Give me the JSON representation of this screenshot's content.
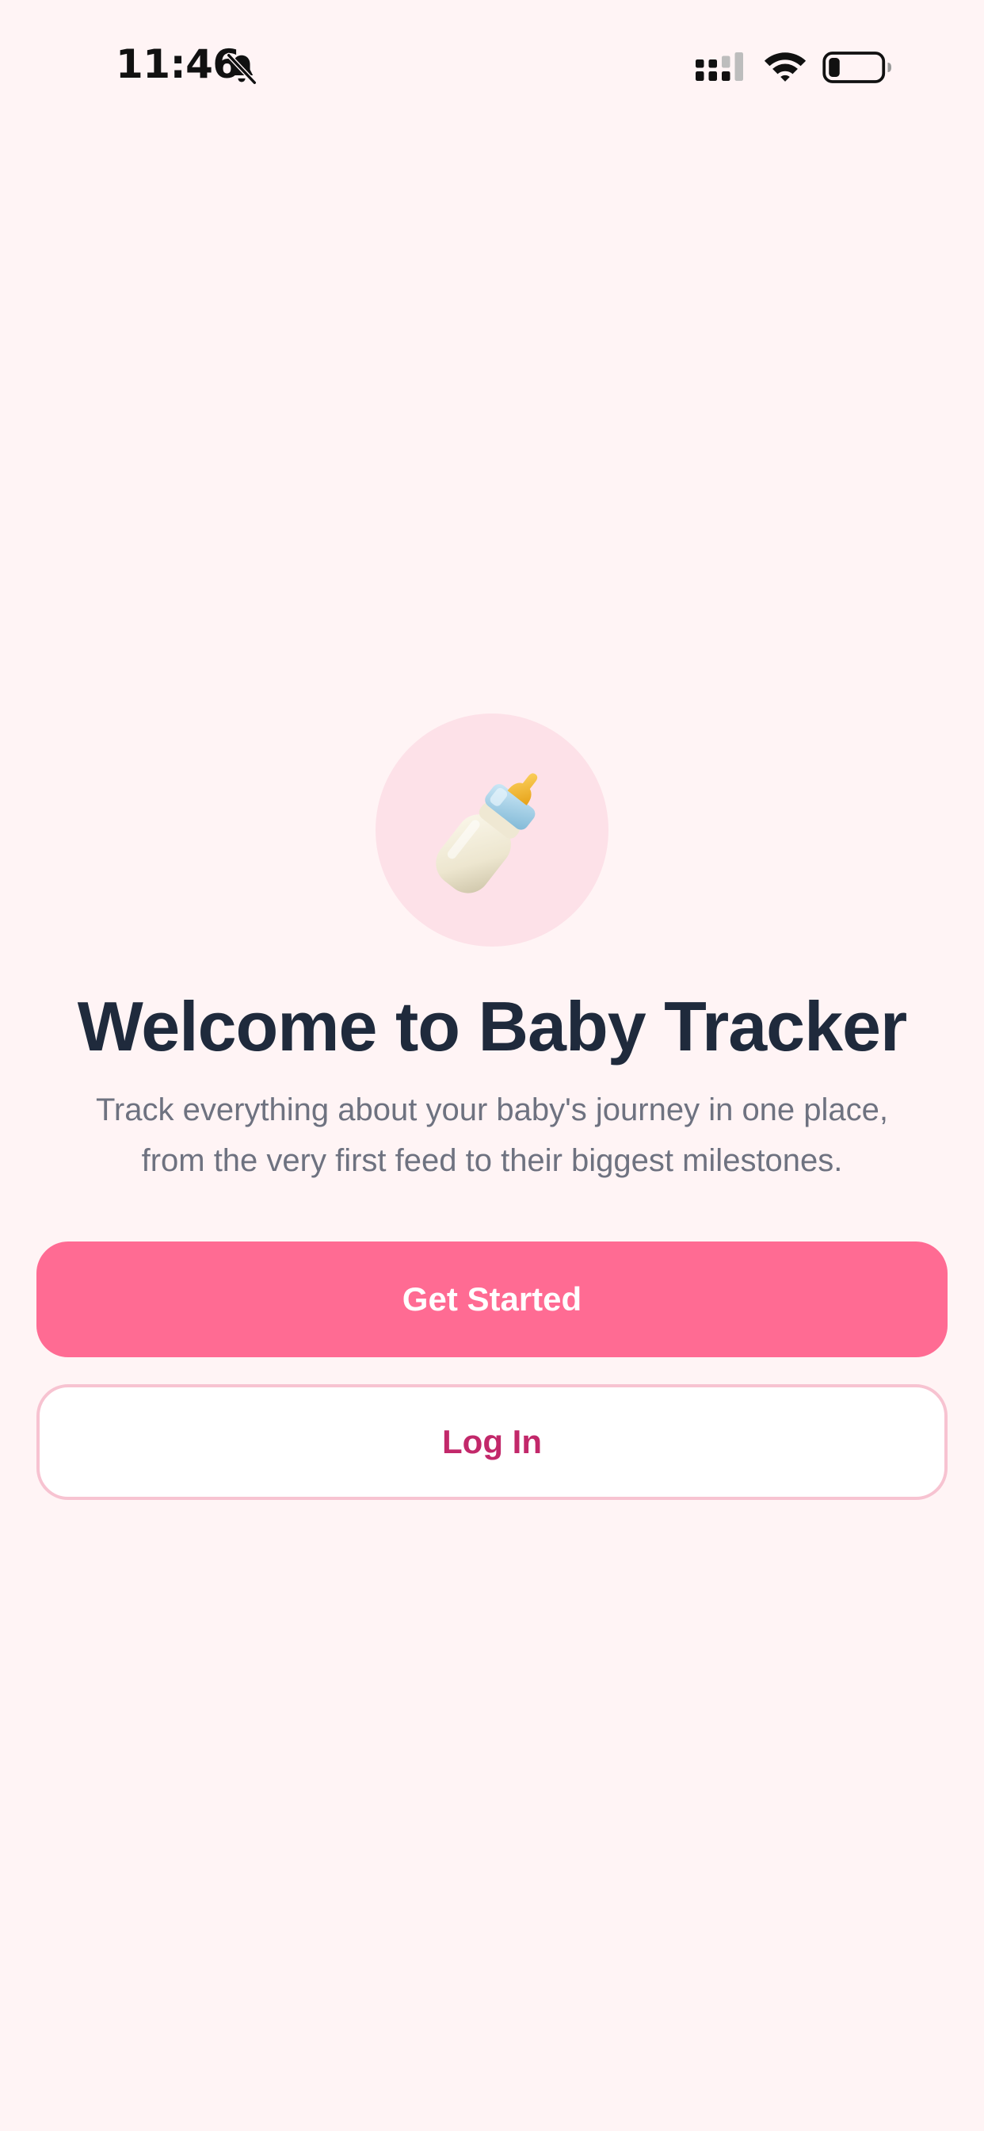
{
  "status_bar": {
    "time": "11:46",
    "icons": [
      "bell-slash-icon",
      "signal-icon",
      "wifi-icon",
      "battery-icon"
    ],
    "battery_level": 0.2
  },
  "welcome": {
    "logo_icon": "baby-bottle-icon",
    "title": "Welcome to Baby Tracker",
    "subtitle_line1": "Track everything about your baby's journey in one place,",
    "subtitle_line2": "from the very first feed to their biggest milestones."
  },
  "actions": {
    "get_started_label": "Get Started",
    "login_label": "Log In"
  },
  "colors": {
    "background": "#FFF4F5",
    "primary": "#FF6B93",
    "primary_text": "#FFFFFF",
    "secondary_border": "#F7C3D1",
    "secondary_text": "#C2286A",
    "title": "#1F2A3C",
    "subtitle": "#6E7280",
    "logo_circle": "#FDE1E8"
  }
}
